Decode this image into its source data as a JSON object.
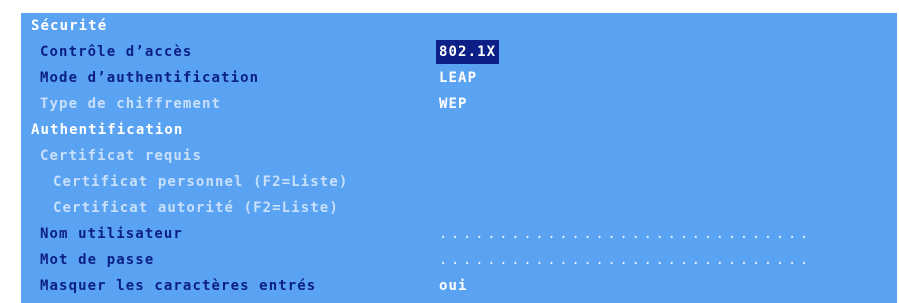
{
  "sections": {
    "security": {
      "title": "Sécurité",
      "access_control": {
        "label": "Contrôle d’accès",
        "value": "802.1X"
      },
      "auth_mode": {
        "label": "Mode d’authentification",
        "value": "LEAP"
      },
      "cipher_type": {
        "label": "Type de chiffrement",
        "value": "WEP"
      }
    },
    "authentication": {
      "title": "Authentification",
      "certificate_required": {
        "label": "Certificat requis"
      },
      "personal_certificate": {
        "label": "Certificat personnel (F2=Liste)"
      },
      "authority_certificate": {
        "label": "Certificat autorité (F2=Liste)"
      },
      "username": {
        "label": "Nom utilisateur",
        "value": "..............................."
      },
      "password": {
        "label": "Mot de passe",
        "value": "..............................."
      },
      "mask_input": {
        "label": "Masquer les caractères entrés",
        "value": "oui"
      }
    }
  },
  "colors": {
    "panel_background": "#5aa2f2",
    "selection_background": "#0b1f86",
    "active_label": "#0b1f86",
    "disabled_label": "#c9e0fb",
    "header_text": "#ffffff"
  }
}
